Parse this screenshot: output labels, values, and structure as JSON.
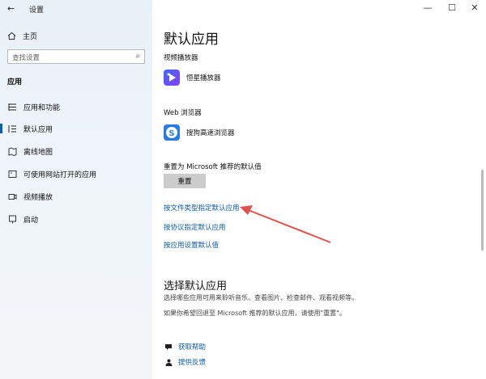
{
  "window": {
    "title": "设置",
    "controls": {
      "minimize": "—",
      "maximize": "☐",
      "close": "✕"
    }
  },
  "sidebar": {
    "home_label": "主页",
    "search_placeholder": "查找设置",
    "section_title": "应用",
    "items": [
      {
        "label": "应用和功能",
        "icon": "list-icon"
      },
      {
        "label": "默认应用",
        "icon": "default-apps-icon",
        "active": true
      },
      {
        "label": "离线地图",
        "icon": "map-icon"
      },
      {
        "label": "可使用网站打开的应用",
        "icon": "web-app-icon"
      },
      {
        "label": "视频播放",
        "icon": "video-icon"
      },
      {
        "label": "启动",
        "icon": "startup-icon"
      }
    ]
  },
  "main": {
    "title": "默认应用",
    "video_player": {
      "label": "视频播放器",
      "app_name": "恒星播放器"
    },
    "web_browser": {
      "label": "Web 浏览器",
      "app_name": "搜狗高速浏览器"
    },
    "reset": {
      "label": "重置为 Microsoft 推荐的默认值",
      "button": "重置"
    },
    "links": [
      "按文件类型指定默认应用",
      "按协议指定默认应用",
      "按应用设置默认值"
    ],
    "choose_section": {
      "title": "选择默认应用",
      "desc1": "选择哪些应用可用来聆听音乐、查看图片、检查邮件、观看视频等。",
      "desc2": "如果你希望回退至 Microsoft 推荐的默认应用，请使用\"重置\"。"
    },
    "help": {
      "get_help": "获取帮助",
      "feedback": "提供反馈"
    }
  },
  "colors": {
    "accent": "#0a5cad",
    "annotation_arrow": "#e0524a"
  }
}
